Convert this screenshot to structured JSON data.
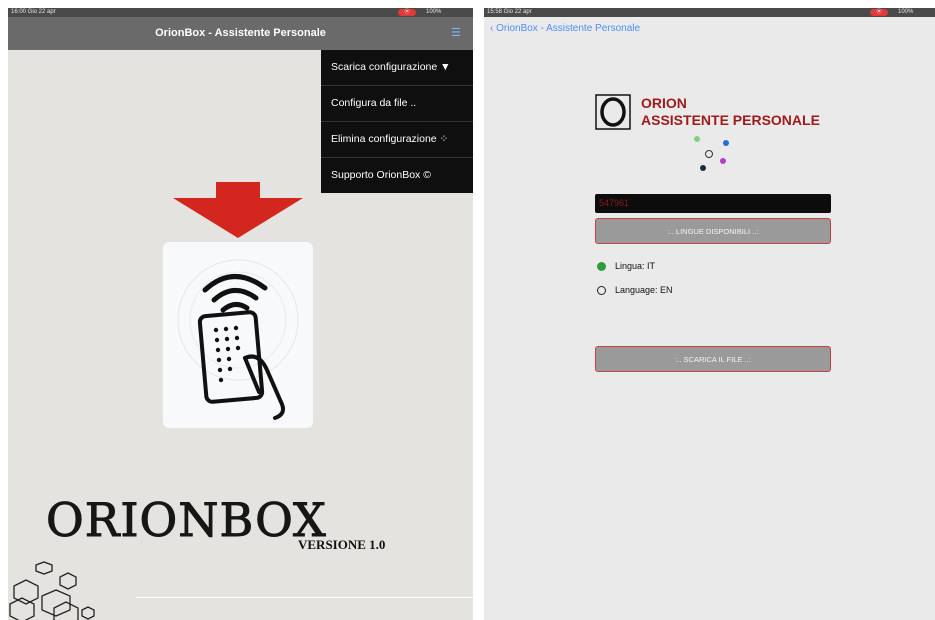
{
  "left": {
    "status": {
      "time": "16:00 Gio 22 apr",
      "battery": "100%"
    },
    "nav": {
      "title": "OrionBox - Assistente Personale"
    },
    "menu": [
      {
        "label": "Scarica configurazione ▼"
      },
      {
        "label": "Configura da file .."
      },
      {
        "label": "Elimina configurazione ⁘"
      },
      {
        "label": "Supporto OrionBox ©"
      }
    ],
    "logo": {
      "text": "ORIONBOX",
      "version": "VERSIONE 1.0"
    },
    "colors": {
      "arrow": "#d3261e",
      "menu_bg": "#0f0f0f",
      "nav_bg": "#6a6a6a"
    }
  },
  "right": {
    "status": {
      "time": "15:58 Gio 22 apr",
      "battery": "100%"
    },
    "nav": {
      "back": "OrionBox - Assistente Personale"
    },
    "brand": {
      "line1": "ORION",
      "line2": "ASSISTENTE PERSONALE"
    },
    "code_value": "547961",
    "languages_button": ":.. LINGUE DISPONIBILI ..:",
    "languages": [
      {
        "label": "Lingua: IT",
        "selected": true
      },
      {
        "label": "Language: EN",
        "selected": false
      }
    ],
    "download_button": ":.. SCARICA IL FILE ..:",
    "colors": {
      "brand": "#9e1b1b",
      "button": "#9a9a9a",
      "selected": "#2e9b3c"
    }
  }
}
